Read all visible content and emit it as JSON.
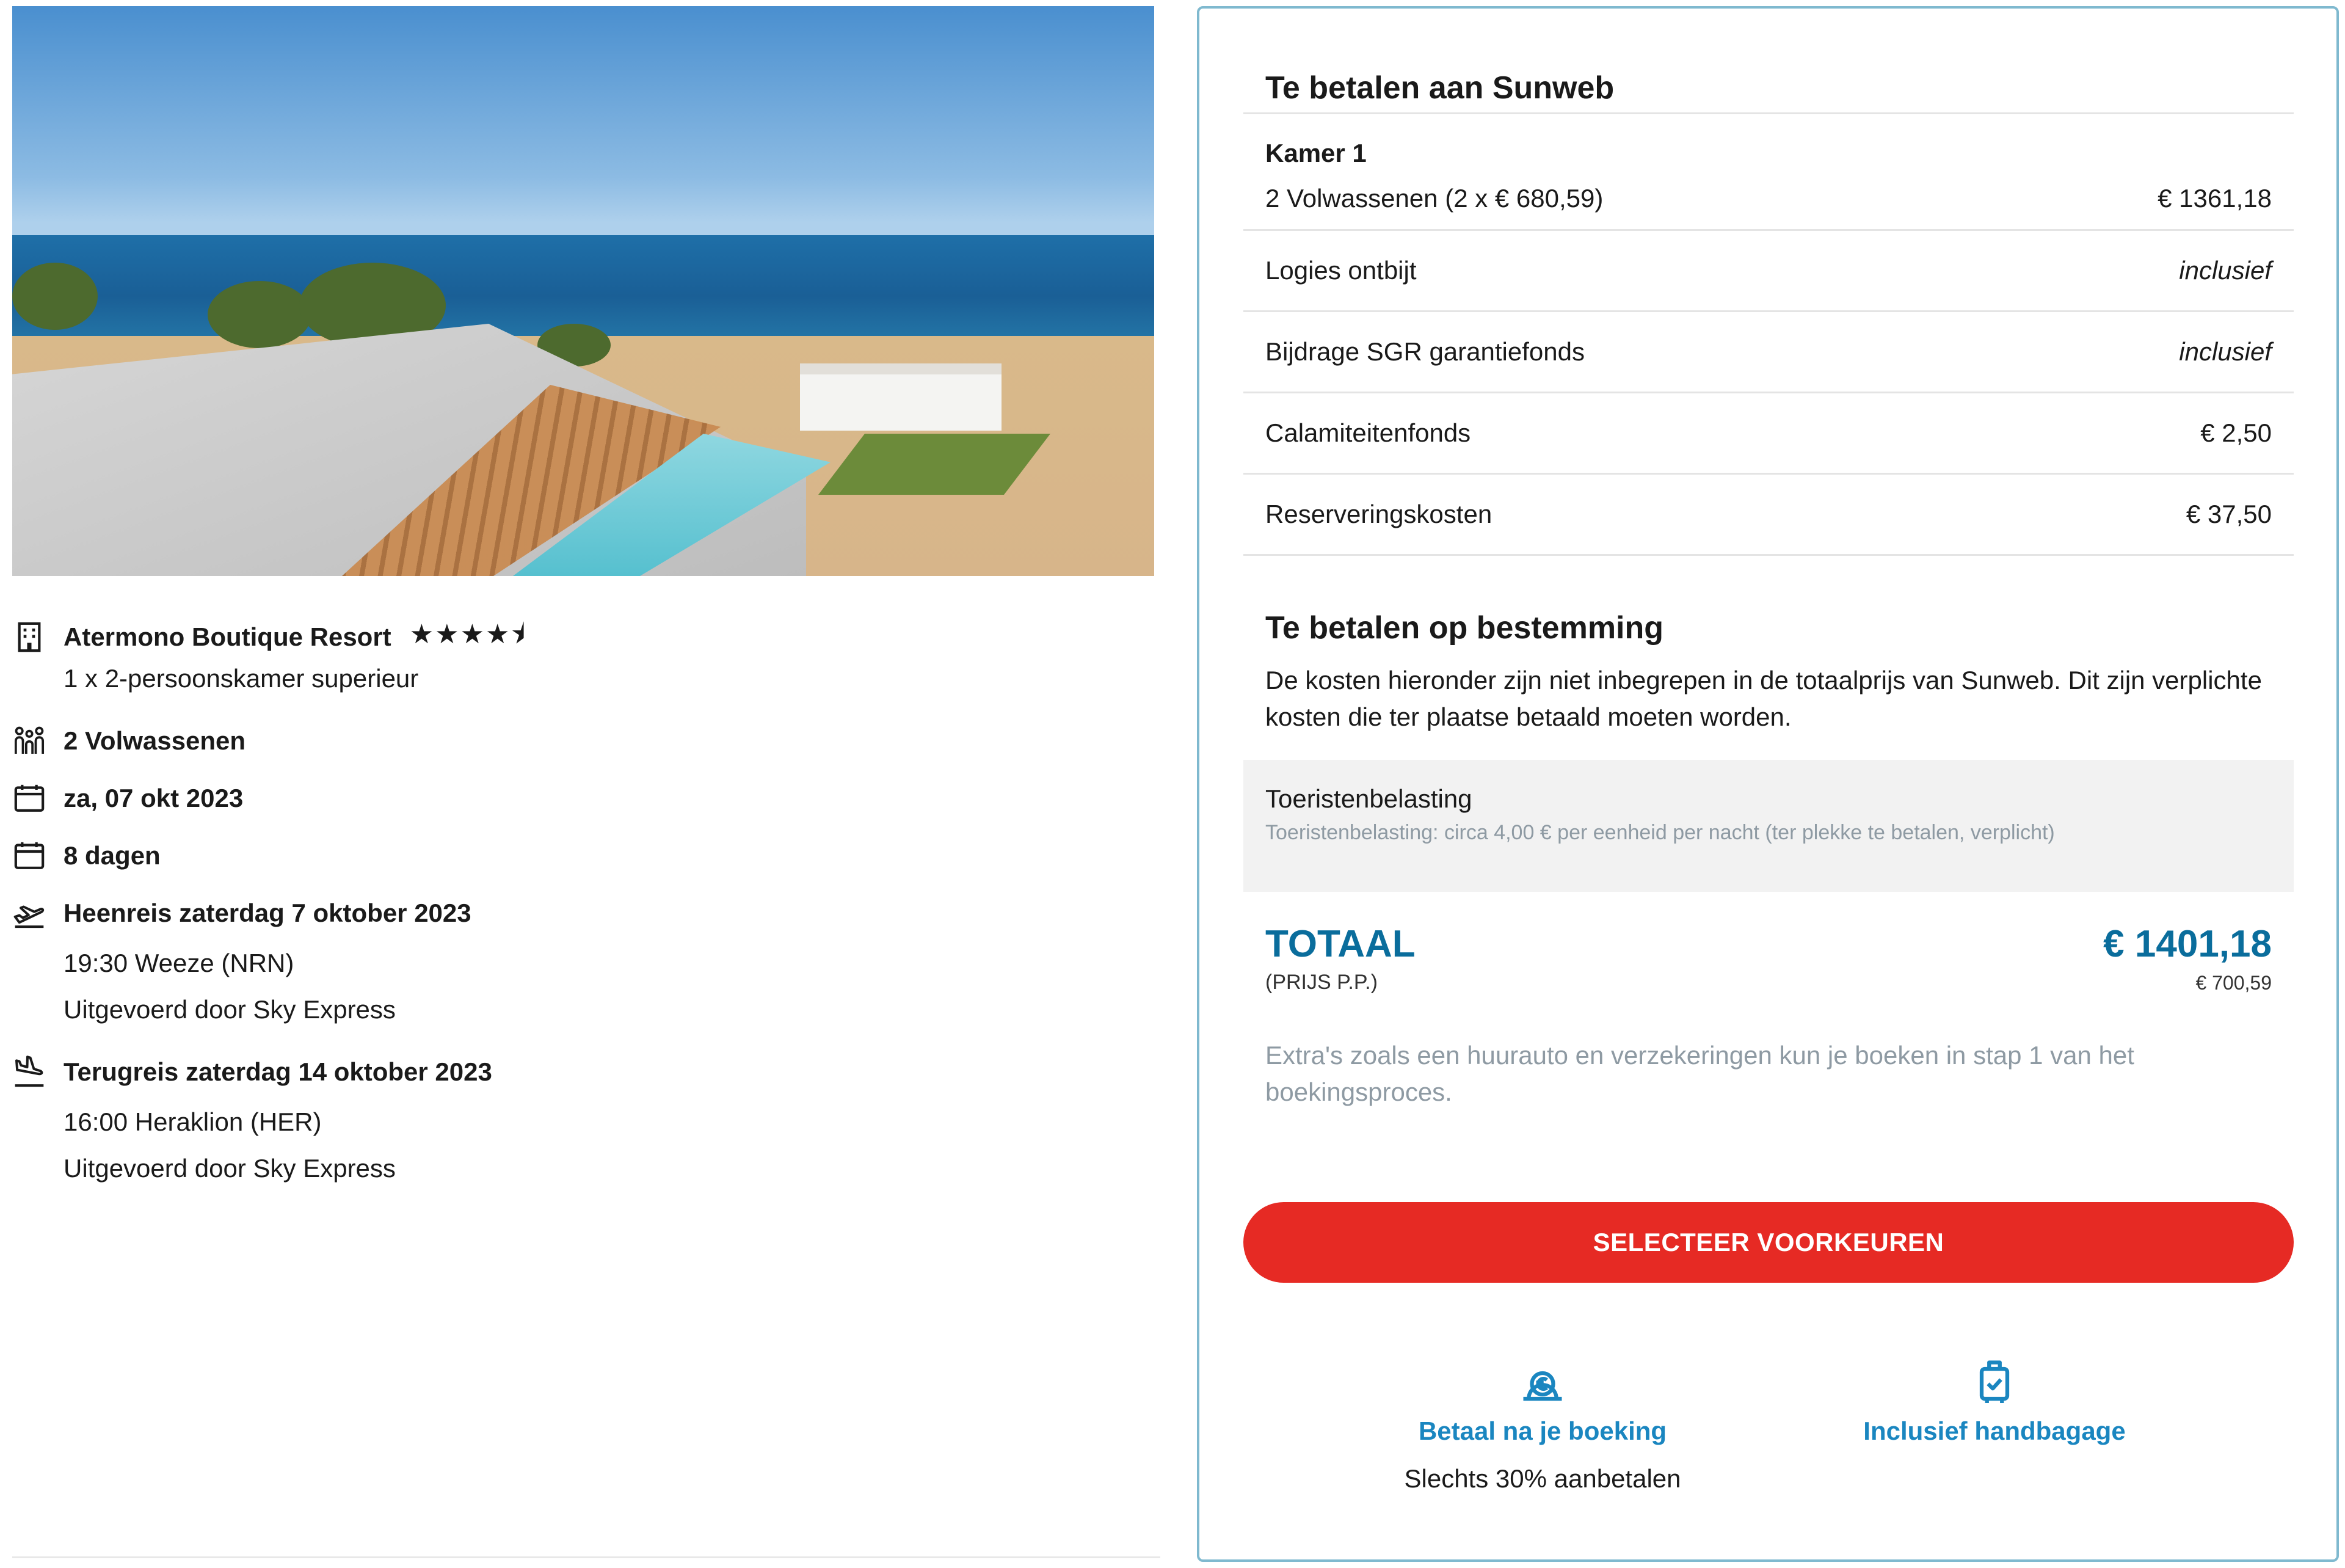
{
  "hotel": {
    "name": "Atermono Boutique Resort",
    "stars": "★★★★⯨",
    "room": "1 x 2-persoonskamer superieur"
  },
  "travellers": "2 Volwassenen",
  "date": "za, 07 okt 2023",
  "duration": "8 dagen",
  "outbound": {
    "title": "Heenreis zaterdag 7 oktober 2023",
    "time": "19:30 Weeze (NRN)",
    "carrier": "Uitgevoerd door Sky Express"
  },
  "return": {
    "title": "Terugreis zaterdag 14 oktober 2023",
    "time": "16:00 Heraklion (HER)",
    "carrier": "Uitgevoerd door Sky Express"
  },
  "summary": {
    "title": "Te betalen aan Sunweb",
    "room_label": "Kamer 1",
    "lines": [
      {
        "label": "2 Volwassenen (2 x € 680,59)",
        "value": "€ 1361,18"
      },
      {
        "label": "Logies ontbijt",
        "value": "inclusief"
      },
      {
        "label": "Bijdrage SGR garantiefonds",
        "value": "inclusief"
      },
      {
        "label": "Calamiteitenfonds",
        "value": "€ 2,50"
      },
      {
        "label": "Reserveringskosten",
        "value": "€ 37,50"
      }
    ]
  },
  "destination": {
    "title": "Te betalen op bestemming",
    "text": "De kosten hieronder zijn niet inbegrepen in de totaalprijs van Sunweb. Dit zijn verplichte kosten die ter plaatse betaald moeten worden.",
    "tax_title": "Toeristenbelasting",
    "tax_text": "Toeristenbelasting: circa 4,00 € per eenheid per nacht (ter plekke te betalen, verplicht)"
  },
  "total": {
    "label": "TOTAAL",
    "sub_label": "(PRIJS P.P.)",
    "amount": "€ 1401,18",
    "per_person": "€ 700,59"
  },
  "extras_text": "Extra's zoals een huurauto en verzekeringen kun je boeken in stap 1 van het boekingsproces.",
  "cta_label": "SELECTEER VOORKEUREN",
  "usps": [
    {
      "title": "Betaal na je boeking",
      "subtitle": "Slechts 30% aanbetalen",
      "icon": "euro-coin-icon"
    },
    {
      "title": "Inclusief handbagage",
      "subtitle": "",
      "icon": "luggage-check-icon"
    }
  ],
  "colors": {
    "accent_blue": "#0a6d9c",
    "usp_blue": "#1a86c0",
    "cta_red": "#e62a24",
    "card_border": "#7fb9cf"
  }
}
